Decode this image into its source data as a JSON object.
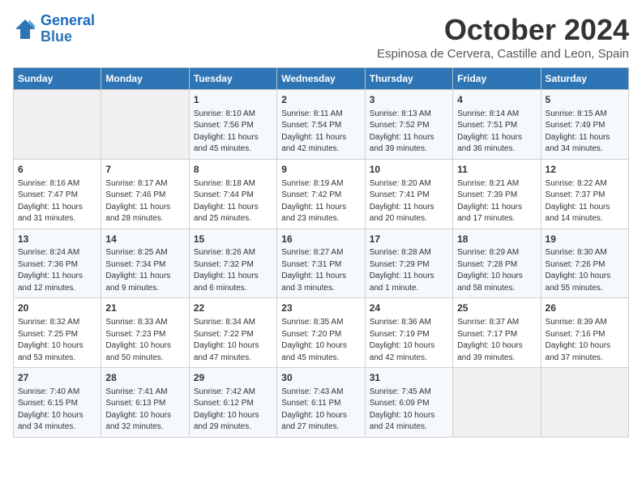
{
  "logo": {
    "line1": "General",
    "line2": "Blue"
  },
  "title": "October 2024",
  "location": "Espinosa de Cervera, Castille and Leon, Spain",
  "weekdays": [
    "Sunday",
    "Monday",
    "Tuesday",
    "Wednesday",
    "Thursday",
    "Friday",
    "Saturday"
  ],
  "weeks": [
    [
      {
        "day": "",
        "info": ""
      },
      {
        "day": "",
        "info": ""
      },
      {
        "day": "1",
        "info": "Sunrise: 8:10 AM\nSunset: 7:56 PM\nDaylight: 11 hours and 45 minutes."
      },
      {
        "day": "2",
        "info": "Sunrise: 8:11 AM\nSunset: 7:54 PM\nDaylight: 11 hours and 42 minutes."
      },
      {
        "day": "3",
        "info": "Sunrise: 8:13 AM\nSunset: 7:52 PM\nDaylight: 11 hours and 39 minutes."
      },
      {
        "day": "4",
        "info": "Sunrise: 8:14 AM\nSunset: 7:51 PM\nDaylight: 11 hours and 36 minutes."
      },
      {
        "day": "5",
        "info": "Sunrise: 8:15 AM\nSunset: 7:49 PM\nDaylight: 11 hours and 34 minutes."
      }
    ],
    [
      {
        "day": "6",
        "info": "Sunrise: 8:16 AM\nSunset: 7:47 PM\nDaylight: 11 hours and 31 minutes."
      },
      {
        "day": "7",
        "info": "Sunrise: 8:17 AM\nSunset: 7:46 PM\nDaylight: 11 hours and 28 minutes."
      },
      {
        "day": "8",
        "info": "Sunrise: 8:18 AM\nSunset: 7:44 PM\nDaylight: 11 hours and 25 minutes."
      },
      {
        "day": "9",
        "info": "Sunrise: 8:19 AM\nSunset: 7:42 PM\nDaylight: 11 hours and 23 minutes."
      },
      {
        "day": "10",
        "info": "Sunrise: 8:20 AM\nSunset: 7:41 PM\nDaylight: 11 hours and 20 minutes."
      },
      {
        "day": "11",
        "info": "Sunrise: 8:21 AM\nSunset: 7:39 PM\nDaylight: 11 hours and 17 minutes."
      },
      {
        "day": "12",
        "info": "Sunrise: 8:22 AM\nSunset: 7:37 PM\nDaylight: 11 hours and 14 minutes."
      }
    ],
    [
      {
        "day": "13",
        "info": "Sunrise: 8:24 AM\nSunset: 7:36 PM\nDaylight: 11 hours and 12 minutes."
      },
      {
        "day": "14",
        "info": "Sunrise: 8:25 AM\nSunset: 7:34 PM\nDaylight: 11 hours and 9 minutes."
      },
      {
        "day": "15",
        "info": "Sunrise: 8:26 AM\nSunset: 7:32 PM\nDaylight: 11 hours and 6 minutes."
      },
      {
        "day": "16",
        "info": "Sunrise: 8:27 AM\nSunset: 7:31 PM\nDaylight: 11 hours and 3 minutes."
      },
      {
        "day": "17",
        "info": "Sunrise: 8:28 AM\nSunset: 7:29 PM\nDaylight: 11 hours and 1 minute."
      },
      {
        "day": "18",
        "info": "Sunrise: 8:29 AM\nSunset: 7:28 PM\nDaylight: 10 hours and 58 minutes."
      },
      {
        "day": "19",
        "info": "Sunrise: 8:30 AM\nSunset: 7:26 PM\nDaylight: 10 hours and 55 minutes."
      }
    ],
    [
      {
        "day": "20",
        "info": "Sunrise: 8:32 AM\nSunset: 7:25 PM\nDaylight: 10 hours and 53 minutes."
      },
      {
        "day": "21",
        "info": "Sunrise: 8:33 AM\nSunset: 7:23 PM\nDaylight: 10 hours and 50 minutes."
      },
      {
        "day": "22",
        "info": "Sunrise: 8:34 AM\nSunset: 7:22 PM\nDaylight: 10 hours and 47 minutes."
      },
      {
        "day": "23",
        "info": "Sunrise: 8:35 AM\nSunset: 7:20 PM\nDaylight: 10 hours and 45 minutes."
      },
      {
        "day": "24",
        "info": "Sunrise: 8:36 AM\nSunset: 7:19 PM\nDaylight: 10 hours and 42 minutes."
      },
      {
        "day": "25",
        "info": "Sunrise: 8:37 AM\nSunset: 7:17 PM\nDaylight: 10 hours and 39 minutes."
      },
      {
        "day": "26",
        "info": "Sunrise: 8:39 AM\nSunset: 7:16 PM\nDaylight: 10 hours and 37 minutes."
      }
    ],
    [
      {
        "day": "27",
        "info": "Sunrise: 7:40 AM\nSunset: 6:15 PM\nDaylight: 10 hours and 34 minutes."
      },
      {
        "day": "28",
        "info": "Sunrise: 7:41 AM\nSunset: 6:13 PM\nDaylight: 10 hours and 32 minutes."
      },
      {
        "day": "29",
        "info": "Sunrise: 7:42 AM\nSunset: 6:12 PM\nDaylight: 10 hours and 29 minutes."
      },
      {
        "day": "30",
        "info": "Sunrise: 7:43 AM\nSunset: 6:11 PM\nDaylight: 10 hours and 27 minutes."
      },
      {
        "day": "31",
        "info": "Sunrise: 7:45 AM\nSunset: 6:09 PM\nDaylight: 10 hours and 24 minutes."
      },
      {
        "day": "",
        "info": ""
      },
      {
        "day": "",
        "info": ""
      }
    ]
  ]
}
